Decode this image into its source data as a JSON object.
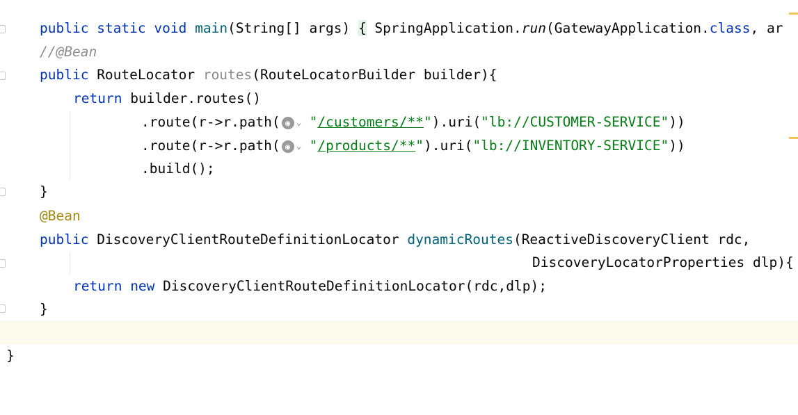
{
  "editor": {
    "line1": {
      "public": "public",
      "static": "static",
      "void": "void",
      "main": "main",
      "params": "(String[] args) ",
      "brace": "{",
      "call": " SpringApplication.",
      "run": "run",
      "args": "(GatewayApplication.",
      "class": "class",
      ", ar": ", ar"
    },
    "line2": {
      "comment": "//@Bean"
    },
    "line3": {
      "public": "public",
      "type": " RouteLocator ",
      "name": "routes",
      "params": "(RouteLocatorBuilder builder){"
    },
    "line4": {
      "return": "return",
      "rest": " builder.routes()"
    },
    "line5": {
      "pre": ".route(r->r.path(",
      "q1": "\"",
      "path": "/customers/**",
      "q2": "\"",
      "mid": ").uri(",
      "uri": "\"lb://CUSTOMER-SERVICE\"",
      "end": "))"
    },
    "line6": {
      "pre": ".route(r->r.path(",
      "q1": "\"",
      "path": "/products/**",
      "q2": "\"",
      "mid": ").uri(",
      "uri": "\"lb://INVENTORY-SERVICE\"",
      "end": "))"
    },
    "line7": {
      "text": ".build();"
    },
    "line8": {
      "text": "}"
    },
    "line9": {
      "annotation": "@Bean"
    },
    "line10": {
      "public": "public",
      "type": " DiscoveryClientRouteDefinitionLocator ",
      "name": "dynamicRoutes",
      "params": "(ReactiveDiscoveryClient rdc,"
    },
    "line11": {
      "text": "DiscoveryLocatorProperties dlp){"
    },
    "line12": {
      "return": "return",
      "new": " new",
      "rest": " DiscoveryClientRouteDefinitionLocator(rdc,dlp);"
    },
    "line13": {
      "text": "}"
    },
    "line15": {
      "text": "}"
    }
  },
  "icons": {
    "globe": "globe-icon",
    "chevron": "chevron-down-icon"
  },
  "colors": {
    "keyword": "#0033b3",
    "function": "#00627a",
    "string": "#067d17",
    "annotation": "#9e880d",
    "comment": "#8c8c8c",
    "current_line": "#fcfaed",
    "marker": "#f2c55c"
  }
}
